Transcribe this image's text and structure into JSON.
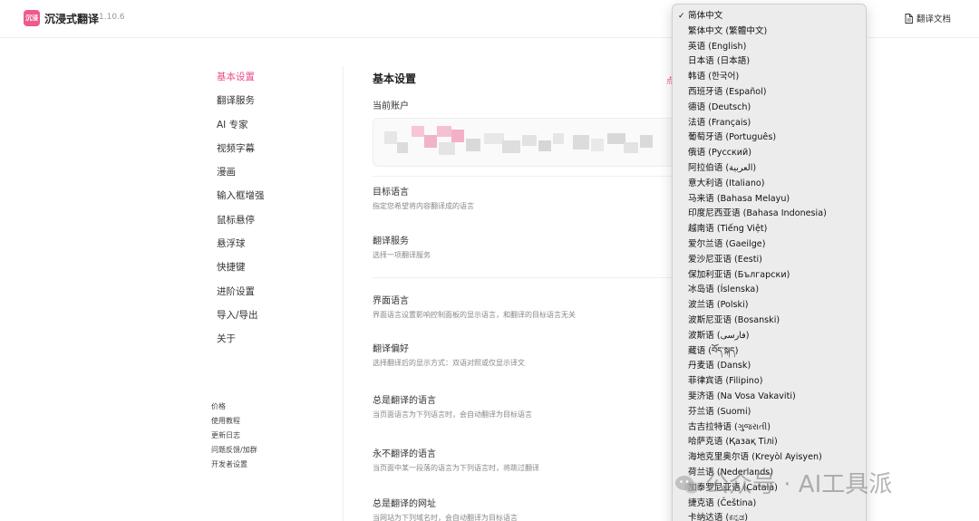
{
  "header": {
    "logo_text": "沉浸",
    "app_name": "沉浸式翻译",
    "version": "1.10.6",
    "doc_link": "翻译文档"
  },
  "sidebar": {
    "items": [
      {
        "label": "基本设置",
        "active": true
      },
      {
        "label": "翻译服务"
      },
      {
        "label": "AI 专家"
      },
      {
        "label": "视频字幕"
      },
      {
        "label": "漫画"
      },
      {
        "label": "输入框增强"
      },
      {
        "label": "鼠标悬停"
      },
      {
        "label": "悬浮球"
      },
      {
        "label": "快捷键"
      },
      {
        "label": "进阶设置"
      },
      {
        "label": "导入/导出"
      },
      {
        "label": "关于"
      }
    ],
    "footer_links": [
      "价格",
      "使用教程",
      "更新日志",
      "问题反馈/加群",
      "开发者设置"
    ]
  },
  "main": {
    "section_title": "基本设置",
    "account_label": "当前账户",
    "red_mark": "点",
    "settings": [
      {
        "title": "目标语言",
        "desc": "指定您希望将内容翻译成的语言"
      },
      {
        "title": "翻译服务",
        "desc": "选择一项翻译服务"
      },
      {
        "title": "界面语言",
        "desc": "界面语言设置影响控制面板的显示语言，和翻译的目标语言无关"
      },
      {
        "title": "翻译偏好",
        "desc": "选择翻译后的显示方式：双语对照或仅显示译文"
      },
      {
        "title": "总是翻译的语言",
        "desc": "当页面语言为下列语言时，会自动翻译为目标语言"
      },
      {
        "title": "永不翻译的语言",
        "desc": "当页面中某一段落的语言为下列语言时，将跳过翻译"
      },
      {
        "title": "总是翻译的网址",
        "desc": "当网站为下列域名时，会自动翻译为目标语言"
      }
    ]
  },
  "dropdown": {
    "checkmark": "✓",
    "options": [
      "简体中文",
      "繁体中文 (繁體中文)",
      "英语 (English)",
      "日本语 (日本語)",
      "韩语 (한국어)",
      "西班牙语 (Español)",
      "德语 (Deutsch)",
      "法语 (Français)",
      "葡萄牙语 (Português)",
      "俄语 (Русский)",
      "阿拉伯语 (العربية)",
      "意大利语 (Italiano)",
      "马来语 (Bahasa Melayu)",
      "印度尼西亚语 (Bahasa Indonesia)",
      "越南语 (Tiếng Việt)",
      "爱尔兰语 (Gaeilge)",
      "爱沙尼亚语 (Eesti)",
      "保加利亚语 (Български)",
      "冰岛语 (Íslenska)",
      "波兰语 (Polski)",
      "波斯尼亚语 (Bosanski)",
      "波斯语 (فارسی)",
      "藏语 (བོད་སྐད)",
      "丹麦语 (Dansk)",
      "菲律宾语 (Filipino)",
      "斐济语 (Na Vosa Vakaviti)",
      "芬兰语 (Suomi)",
      "古吉拉特语 (ગુજરાતી)",
      "哈萨克语 (Қазақ Тілі)",
      "海地克里奥尔语 (Kreyòl Ayisyen)",
      "荷兰语 (Nederlands)",
      "加泰罗尼亚语 (Català)",
      "捷克语 (Čeština)",
      "卡纳达语 (ಕನ್ನಡ)"
    ],
    "selected_index": 0
  },
  "watermark": {
    "text": "公众号 · AI工具派"
  }
}
